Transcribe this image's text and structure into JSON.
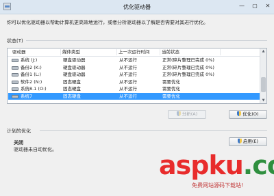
{
  "window": {
    "title": "优化驱动器",
    "controls": [
      "—",
      "▢",
      "✕"
    ]
  },
  "intro": "你可以优化驱动器以帮助计算机更高效地运行，或者分析驱动器以了解是否需要对其进行优化。",
  "status_section": {
    "label": "状态(T)"
  },
  "table": {
    "columns": [
      "驱动器",
      "媒体类型",
      "上一次运行时间",
      "当前状态"
    ],
    "rows": [
      {
        "drive": "系统 (J:)",
        "media": "硬盘驱动器",
        "last_run": "从不运行",
        "status": "正常(碎片整理已完成 0%)",
        "selected": false
      },
      {
        "drive": "备份2 (K:)",
        "media": "硬盘驱动器",
        "last_run": "从不运行",
        "status": "正常(碎片整理已完成 0%)",
        "selected": false
      },
      {
        "drive": "备份1 (L:)",
        "media": "硬盘驱动器",
        "last_run": "从不运行",
        "status": "正常(碎片整理已完成 0%)",
        "selected": false
      },
      {
        "drive": "软件2 (N:)",
        "media": "固态硬盘",
        "last_run": "从不运行",
        "status": "需要优化",
        "selected": false
      },
      {
        "drive": "系统8.1 (O:)",
        "media": "固态硬盘",
        "last_run": "从不运行",
        "status": "需要优化",
        "selected": false
      },
      {
        "drive": "系统7",
        "media": "固态硬盘",
        "last_run": "从不运行",
        "status": "需要优化",
        "selected": true
      }
    ]
  },
  "buttons": {
    "analyze": "分析(A)",
    "optimize": "优化(O)",
    "enable": "启用(E)"
  },
  "schedule": {
    "label": "计划的优化",
    "state": "关闭",
    "description": "驱动器未自动优化。"
  },
  "watermark": {
    "main": "aspku",
    "tld": ".com",
    "sub": "免费网站源码下载站!"
  },
  "colors": {
    "selection": "#3399ff",
    "watermark": "#e82c2c"
  }
}
